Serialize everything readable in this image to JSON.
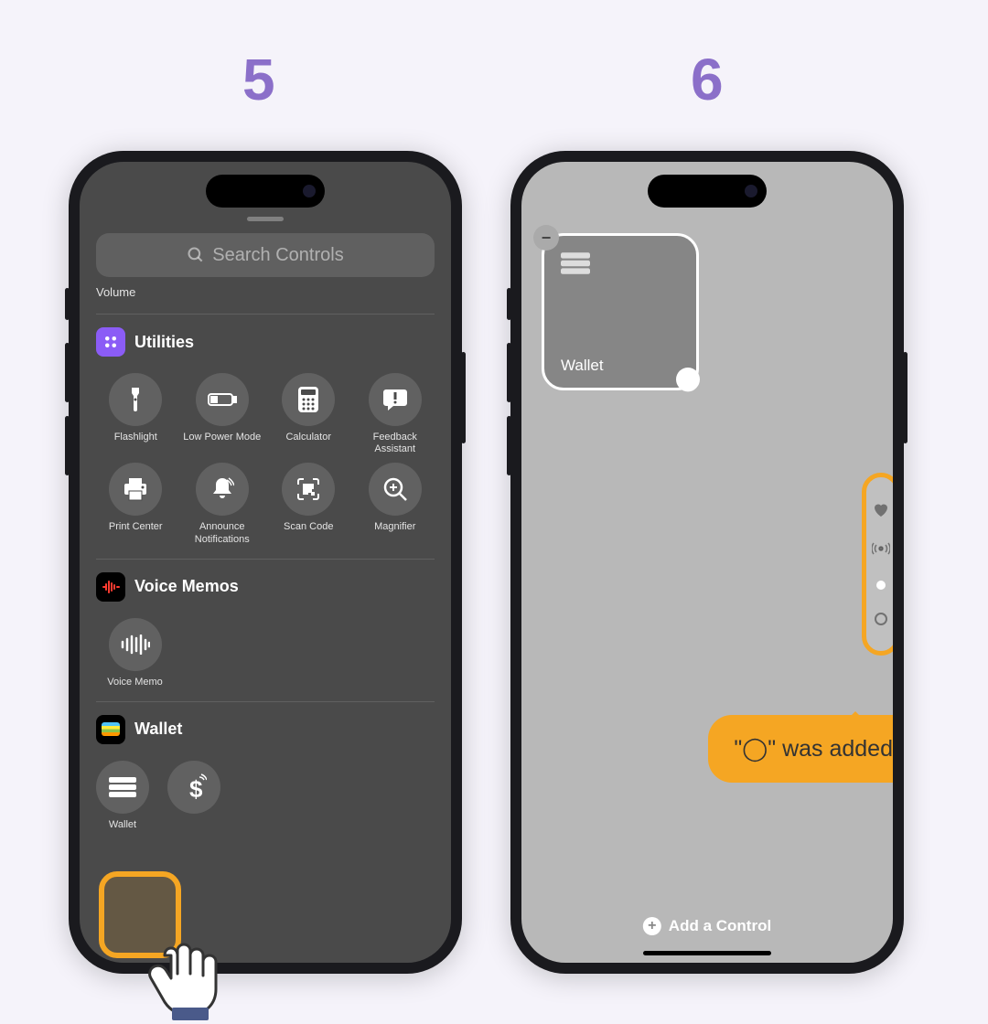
{
  "steps": {
    "left": "5",
    "right": "6"
  },
  "left": {
    "search_placeholder": "Search Controls",
    "volume_label": "Volume",
    "utilities": {
      "title": "Utilities",
      "items": [
        {
          "label": "Flashlight"
        },
        {
          "label": "Low Power Mode"
        },
        {
          "label": "Calculator"
        },
        {
          "label": "Feedback Assistant"
        },
        {
          "label": "Print Center"
        },
        {
          "label": "Announce Notifications"
        },
        {
          "label": "Scan Code"
        },
        {
          "label": "Magnifier"
        }
      ]
    },
    "voice_memos": {
      "title": "Voice Memos",
      "item_label": "Voice Memo"
    },
    "wallet": {
      "title": "Wallet",
      "item_label": "Wallet"
    }
  },
  "right": {
    "widget_label": "Wallet",
    "add_control": "Add a Control",
    "callout": "\"◯\" was added"
  }
}
